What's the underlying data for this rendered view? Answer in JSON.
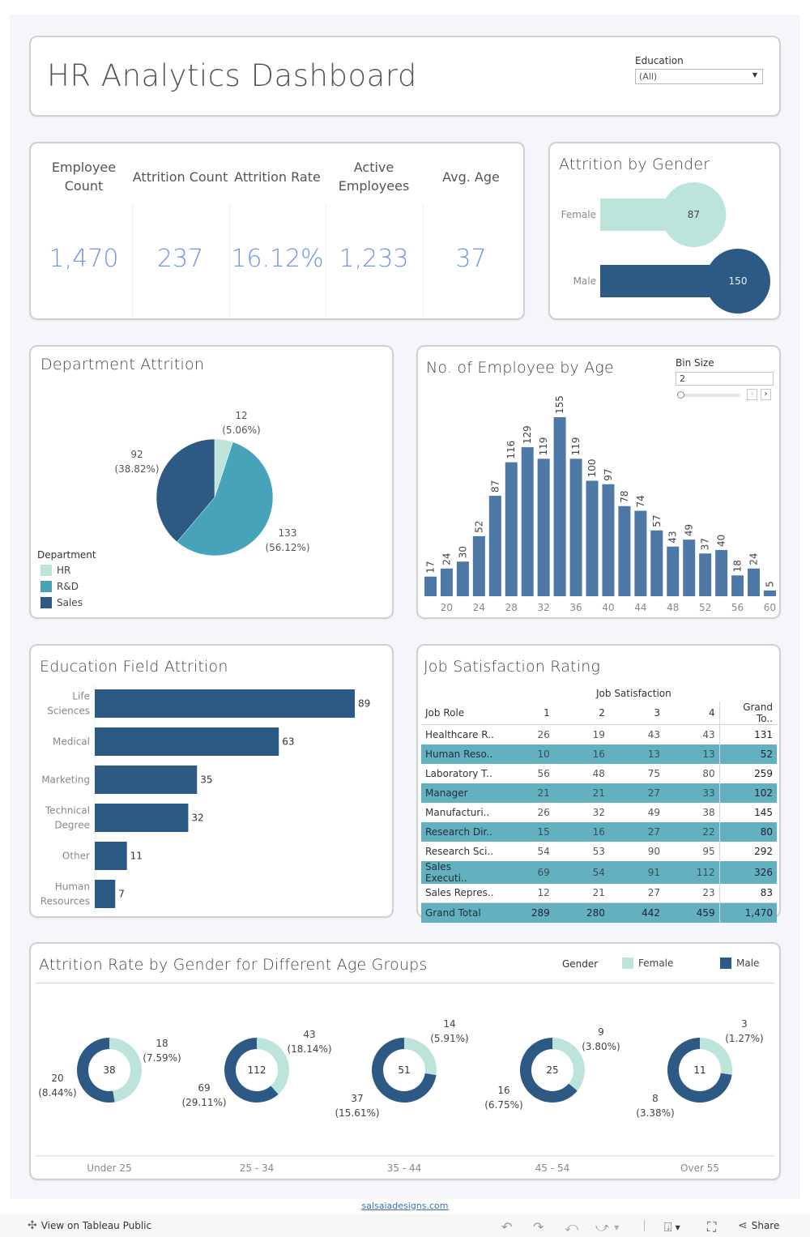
{
  "header": {
    "title": "HR Analytics Dashboard",
    "filter_label": "Education",
    "filter_value": "(All)"
  },
  "kpis": [
    {
      "label": "Employee Count",
      "value": "1,470"
    },
    {
      "label": "Attrition Count",
      "value": "237"
    },
    {
      "label": "Attrition Rate",
      "value": "16.12%"
    },
    {
      "label": "Active Employees",
      "value": "1,233"
    },
    {
      "label": "Avg. Age",
      "value": "37"
    }
  ],
  "colors": {
    "female": "#bde4da",
    "male": "#2d5985",
    "hr": "#bde4da",
    "rnd": "#46a3ba",
    "sales": "#2d5985",
    "age_bar": "#4e79a7",
    "kpi_value": "#6f95e8",
    "table_band": "#62b0c0"
  },
  "gender_chart": {
    "title": "Attrition by Gender",
    "chart_data": {
      "type": "bar",
      "categories": [
        "Female",
        "Male"
      ],
      "values": [
        87,
        150
      ],
      "title": "Attrition by Gender"
    }
  },
  "dept_chart": {
    "title": "Department Attrition",
    "legend_title": "Department",
    "chart_data": {
      "type": "pie",
      "categories": [
        "HR",
        "R&D",
        "Sales"
      ],
      "values": [
        12,
        133,
        92
      ],
      "labels": [
        "12",
        "133",
        "92"
      ],
      "percent_labels": [
        "(5.06%)",
        "(56.12%)",
        "(38.82%)"
      ],
      "title": "Department Attrition",
      "legend": "bottom-left"
    }
  },
  "age_chart": {
    "title": "No. of Employee by Age",
    "bin_label": "Bin Size",
    "bin_value": "2",
    "chart_data": {
      "type": "bar",
      "title": "No. of Employee by Age",
      "x": [
        18,
        20,
        22,
        24,
        26,
        28,
        30,
        32,
        34,
        36,
        38,
        40,
        42,
        44,
        46,
        48,
        50,
        52,
        54,
        56,
        58,
        60
      ],
      "values": [
        17,
        24,
        30,
        52,
        87,
        116,
        129,
        119,
        155,
        119,
        100,
        97,
        78,
        74,
        57,
        43,
        49,
        37,
        40,
        18,
        24,
        5
      ],
      "tick_labels": [
        "20",
        "24",
        "28",
        "32",
        "36",
        "40",
        "44",
        "48",
        "52",
        "56",
        "60"
      ],
      "ylim": [
        0,
        160
      ],
      "grid": false
    }
  },
  "edu_chart": {
    "title": "Education Field Attrition",
    "chart_data": {
      "type": "bar",
      "orientation": "horizontal",
      "title": "Education Field Attrition",
      "categories": [
        "Life Sciences",
        "Medical",
        "Marketing",
        "Technical Degree",
        "Other",
        "Human Resources"
      ],
      "category_lines": [
        [
          "Life",
          "Sciences"
        ],
        [
          "Medical"
        ],
        [
          "Marketing"
        ],
        [
          "Technical",
          "Degree"
        ],
        [
          "Other"
        ],
        [
          "Human",
          "Resources"
        ]
      ],
      "values": [
        89,
        63,
        35,
        32,
        11,
        7
      ],
      "xlim": [
        0,
        100
      ]
    }
  },
  "job_table": {
    "title": "Job Satisfaction Rating",
    "group_header": "Job Satisfaction",
    "columns": [
      "Job Role",
      "1",
      "2",
      "3",
      "4",
      "Grand To.."
    ],
    "rows": [
      {
        "role": "Healthcare R..",
        "v": [
          "26",
          "19",
          "43",
          "43"
        ],
        "total": "131"
      },
      {
        "role": "Human Reso..",
        "v": [
          "10",
          "16",
          "13",
          "13"
        ],
        "total": "52"
      },
      {
        "role": "Laboratory T..",
        "v": [
          "56",
          "48",
          "75",
          "80"
        ],
        "total": "259"
      },
      {
        "role": "Manager",
        "v": [
          "21",
          "21",
          "27",
          "33"
        ],
        "total": "102"
      },
      {
        "role": "Manufacturi..",
        "v": [
          "26",
          "32",
          "49",
          "38"
        ],
        "total": "145"
      },
      {
        "role": "Research Dir..",
        "v": [
          "15",
          "16",
          "27",
          "22"
        ],
        "total": "80"
      },
      {
        "role": "Research Sci..",
        "v": [
          "54",
          "53",
          "90",
          "95"
        ],
        "total": "292"
      },
      {
        "role": "Sales Executi..",
        "v": [
          "69",
          "54",
          "91",
          "112"
        ],
        "total": "326"
      },
      {
        "role": "Sales Repres..",
        "v": [
          "12",
          "21",
          "27",
          "23"
        ],
        "total": "83"
      }
    ],
    "grand_total": {
      "role": "Grand Total",
      "v": [
        "289",
        "280",
        "442",
        "459"
      ],
      "total": "1,470"
    }
  },
  "agegroup_chart": {
    "title": "Attrition Rate by Gender for Different Age Groups",
    "legend_title": "Gender",
    "legend": [
      "Female",
      "Male"
    ],
    "chart_data": {
      "type": "pie",
      "subtype": "donut",
      "title": "Attrition Rate by Gender for Different Age Groups",
      "categories": [
        "Under 25",
        "25 - 34",
        "35 - 44",
        "45 - 54",
        "Over 55"
      ],
      "series": [
        {
          "name": "Female",
          "values": [
            18,
            43,
            14,
            9,
            3
          ],
          "percent_labels": [
            "(7.59%)",
            "(18.14%)",
            "(5.91%)",
            "(3.80%)",
            "(1.27%)"
          ]
        },
        {
          "name": "Male",
          "values": [
            20,
            69,
            37,
            16,
            8
          ],
          "percent_labels": [
            "(8.44%)",
            "(29.11%)",
            "(15.61%)",
            "(6.75%)",
            "(3.38%)"
          ]
        }
      ],
      "totals": [
        38,
        112,
        51,
        25,
        11
      ],
      "legend": "top-right"
    }
  },
  "footer": {
    "credit": "salsaiadesigns.com",
    "view_label": "View on Tableau Public",
    "share_label": "Share"
  }
}
